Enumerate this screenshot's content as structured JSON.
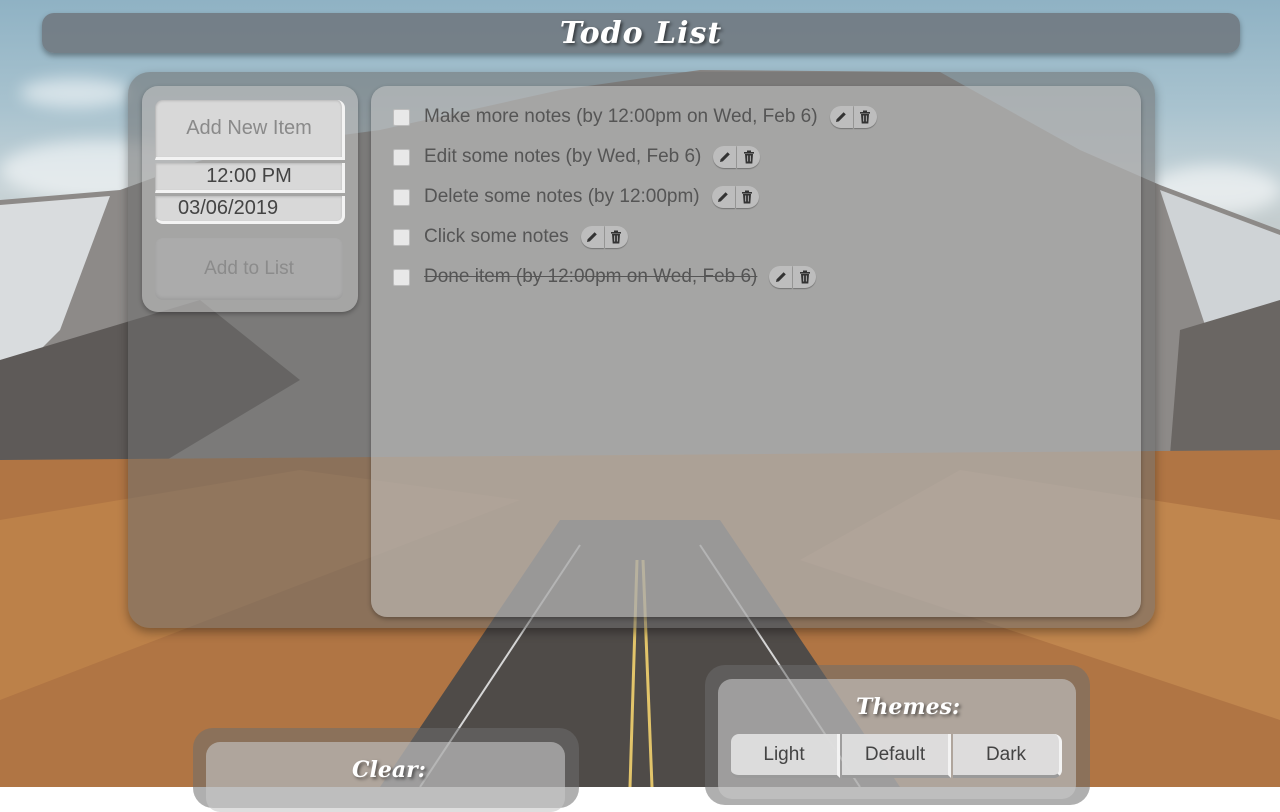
{
  "header": {
    "title": "Todo List"
  },
  "form": {
    "new_item_placeholder": "Add New Item",
    "time_value": "12:00 PM",
    "date_value": "03/06/2019",
    "add_button_label": "Add to List"
  },
  "todos": [
    {
      "text": "Make more notes (by 12:00pm on Wed, Feb 6)",
      "done": false
    },
    {
      "text": "Edit some notes (by Wed, Feb 6)",
      "done": false
    },
    {
      "text": "Delete some notes (by 12:00pm)",
      "done": false
    },
    {
      "text": "Click some notes",
      "done": false
    },
    {
      "text": "Done item (by 12:00pm on Wed, Feb 6)",
      "done": true
    }
  ],
  "icons": {
    "edit": "pencil-icon",
    "delete": "trash-icon"
  },
  "clear": {
    "title": "Clear:"
  },
  "themes": {
    "title": "Themes:",
    "options": [
      "Light",
      "Default",
      "Dark"
    ]
  },
  "colors": {
    "panel": "#6e6e6e",
    "accent": "#6e767c",
    "text": "#555555"
  }
}
